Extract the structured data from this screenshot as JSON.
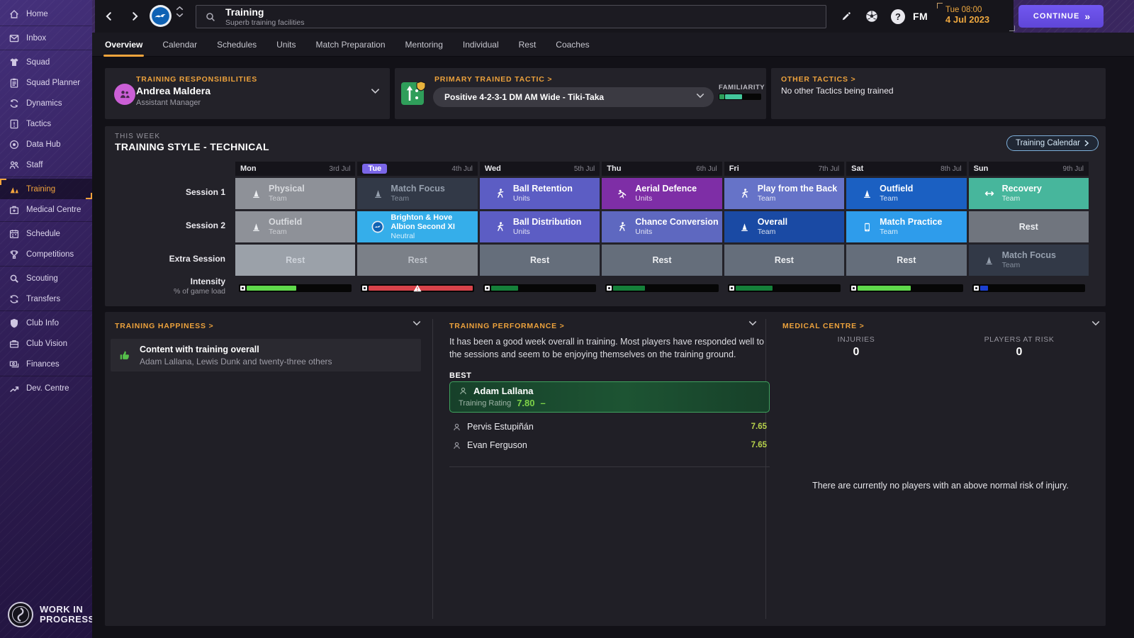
{
  "sidebar": {
    "items": [
      {
        "label": "Home",
        "icon": "home"
      },
      {
        "label": "Inbox",
        "icon": "inbox"
      },
      {
        "label": "Squad",
        "icon": "shirt"
      },
      {
        "label": "Squad Planner",
        "icon": "clipboard"
      },
      {
        "label": "Dynamics",
        "icon": "dynamics"
      },
      {
        "label": "Tactics",
        "icon": "tactics-board"
      },
      {
        "label": "Data Hub",
        "icon": "data-hub"
      },
      {
        "label": "Staff",
        "icon": "staff"
      },
      {
        "label": "Training",
        "icon": "cones"
      },
      {
        "label": "Medical Centre",
        "icon": "medical-bag"
      },
      {
        "label": "Schedule",
        "icon": "calendar"
      },
      {
        "label": "Competitions",
        "icon": "trophy"
      },
      {
        "label": "Scouting",
        "icon": "magnifier"
      },
      {
        "label": "Transfers",
        "icon": "transfer-arrows"
      },
      {
        "label": "Club Info",
        "icon": "shield"
      },
      {
        "label": "Club Vision",
        "icon": "briefcase"
      },
      {
        "label": "Finances",
        "icon": "banknotes"
      },
      {
        "label": "Dev. Centre",
        "icon": "trend-arrow"
      }
    ],
    "wip_line1": "WORK IN",
    "wip_line2": "PROGRESS"
  },
  "header": {
    "title": "Training",
    "subtitle": "Superb training facilities",
    "fm_logo": "FM",
    "clock_time": "Tue 08:00",
    "clock_date": "4 Jul 2023",
    "continue_label": "CONTINUE",
    "continue_chevron": "»"
  },
  "tabs": [
    "Overview",
    "Calendar",
    "Schedules",
    "Units",
    "Match Preparation",
    "Mentoring",
    "Individual",
    "Rest",
    "Coaches"
  ],
  "responsibilities": {
    "heading": "TRAINING RESPONSIBILITIES",
    "name": "Andrea Maldera",
    "role": "Assistant Manager"
  },
  "tactic": {
    "heading": "PRIMARY TRAINED TACTIC >",
    "value": "Positive 4-2-3-1 DM AM Wide - Tiki-Taka",
    "familiarity_label": "FAMILIARITY",
    "familiarity_pct": 40
  },
  "other_tactics": {
    "heading": "OTHER TACTICS >",
    "text": "No other Tactics being trained"
  },
  "week": {
    "kicker": "THIS WEEK",
    "title": "TRAINING STYLE - TECHNICAL",
    "calendar_button": "Training Calendar",
    "row_labels": {
      "session1": "Session 1",
      "session2": "Session 2",
      "extra": "Extra Session",
      "intensity": "Intensity",
      "intensity_sub": "% of game load"
    },
    "days": [
      {
        "name": "Mon",
        "date": "3rd Jul"
      },
      {
        "name": "Tue",
        "date": "4th Jul"
      },
      {
        "name": "Wed",
        "date": "5th Jul"
      },
      {
        "name": "Thu",
        "date": "6th Jul"
      },
      {
        "name": "Fri",
        "date": "7th Jul"
      },
      {
        "name": "Sat",
        "date": "8th Jul"
      },
      {
        "name": "Sun",
        "date": "9th Jul"
      }
    ],
    "session1": [
      {
        "title": "Physical",
        "sub": "Team"
      },
      {
        "title": "Match Focus",
        "sub": "Team"
      },
      {
        "title": "Ball Retention",
        "sub": "Units"
      },
      {
        "title": "Aerial Defence",
        "sub": "Units"
      },
      {
        "title": "Play from the Back",
        "sub": "Team"
      },
      {
        "title": "Outfield",
        "sub": "Team"
      },
      {
        "title": "Recovery",
        "sub": "Team"
      }
    ],
    "session2": [
      {
        "title": "Outfield",
        "sub": "Team"
      },
      {
        "title": "Brighton & Hove Albion Second XI",
        "sub": "Neutral"
      },
      {
        "title": "Ball Distribution",
        "sub": "Units"
      },
      {
        "title": "Chance Conversion",
        "sub": "Units"
      },
      {
        "title": "Overall",
        "sub": "Team"
      },
      {
        "title": "Match Practice",
        "sub": "Team"
      },
      {
        "title": "Rest",
        "sub": ""
      }
    ],
    "extra": [
      {
        "title": "Rest",
        "sub": ""
      },
      {
        "title": "Rest",
        "sub": ""
      },
      {
        "title": "Rest",
        "sub": ""
      },
      {
        "title": "Rest",
        "sub": ""
      },
      {
        "title": "Rest",
        "sub": ""
      },
      {
        "title": "Rest",
        "sub": ""
      },
      {
        "title": "Match Focus",
        "sub": "Team"
      }
    ],
    "intensity": [
      {
        "pct": 44,
        "color": "#5fd84b",
        "warning": false
      },
      {
        "pct": 100,
        "color": "#d8434a",
        "warning": true
      },
      {
        "pct": 24,
        "color": "#15803a",
        "warning": false
      },
      {
        "pct": 28,
        "color": "#15803a",
        "warning": false
      },
      {
        "pct": 33,
        "color": "#15803a",
        "warning": false
      },
      {
        "pct": 47,
        "color": "#5fd84b",
        "warning": false
      },
      {
        "pct": 7,
        "color": "#1b3fd0",
        "warning": false
      }
    ]
  },
  "happiness": {
    "heading": "TRAINING HAPPINESS >",
    "item_title": "Content with training overall",
    "item_sub": "Adam Lallana, Lewis Dunk and twenty-three others"
  },
  "performance": {
    "heading": "TRAINING PERFORMANCE >",
    "summary": "It has been a good week overall in training. Most players have responded well to the sessions and seem to be enjoying themselves on the training ground.",
    "best_label": "BEST",
    "best": {
      "name": "Adam Lallana",
      "rating_label": "Training Rating",
      "rating": "7.80",
      "trend": "–"
    },
    "others": [
      {
        "name": "Pervis Estupiñán",
        "rating": "7.65"
      },
      {
        "name": "Evan Ferguson",
        "rating": "7.65"
      }
    ]
  },
  "medical": {
    "heading": "MEDICAL CENTRE >",
    "injuries_label": "INJURIES",
    "injuries_value": "0",
    "risk_label": "PLAYERS AT RISK",
    "risk_value": "0",
    "note": "There are currently no players with an above normal risk of injury."
  },
  "colors": {
    "accent_orange": "#f2a43c",
    "continue_purple": "#6a50e8",
    "selected_day_purple": "#7a66e8",
    "best_rating_green": "#7ed348",
    "good_rating_green": "#b8d34c",
    "familiarity_teal": "#43c79c",
    "intensity_red": "#d8434a"
  }
}
